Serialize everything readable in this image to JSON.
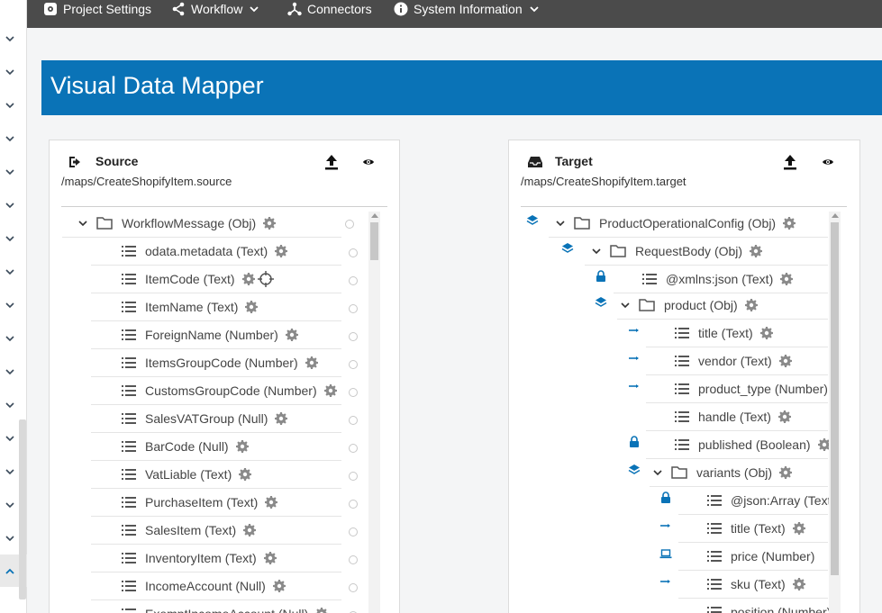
{
  "topbar": {
    "project_settings": "Project Settings",
    "workflow": "Workflow",
    "connectors": "Connectors",
    "system_information": "System Information"
  },
  "header": {
    "title": "Visual Data Mapper"
  },
  "source": {
    "title": "Source",
    "path": "/maps/CreateShopifyItem.source",
    "rows": [
      "WorkflowMessage (Obj)",
      "odata.metadata (Text)",
      "ItemCode (Text)",
      "ItemName (Text)",
      "ForeignName (Number)",
      "ItemsGroupCode (Number)",
      "CustomsGroupCode (Number)",
      "SalesVATGroup (Null)",
      "BarCode (Null)",
      "VatLiable (Text)",
      "PurchaseItem (Text)",
      "SalesItem (Text)",
      "InventoryItem (Text)",
      "IncomeAccount (Null)",
      "ExemptIncomeAccount (Null)"
    ]
  },
  "target": {
    "title": "Target",
    "path": "/maps/CreateShopifyItem.target",
    "rows": [
      "ProductOperationalConfig (Obj)",
      "RequestBody (Obj)",
      "@xmlns:json (Text)",
      "product (Obj)",
      "title (Text)",
      "vendor (Text)",
      "product_type (Number)",
      "handle (Text)",
      "published (Boolean)",
      "variants (Obj)",
      "@json:Array (Text)",
      "title (Text)",
      "price (Number)",
      "sku (Text)",
      "position (Number)"
    ]
  },
  "colors": {
    "accent": "#0a73b7",
    "topbar": "#4b4b4b"
  }
}
